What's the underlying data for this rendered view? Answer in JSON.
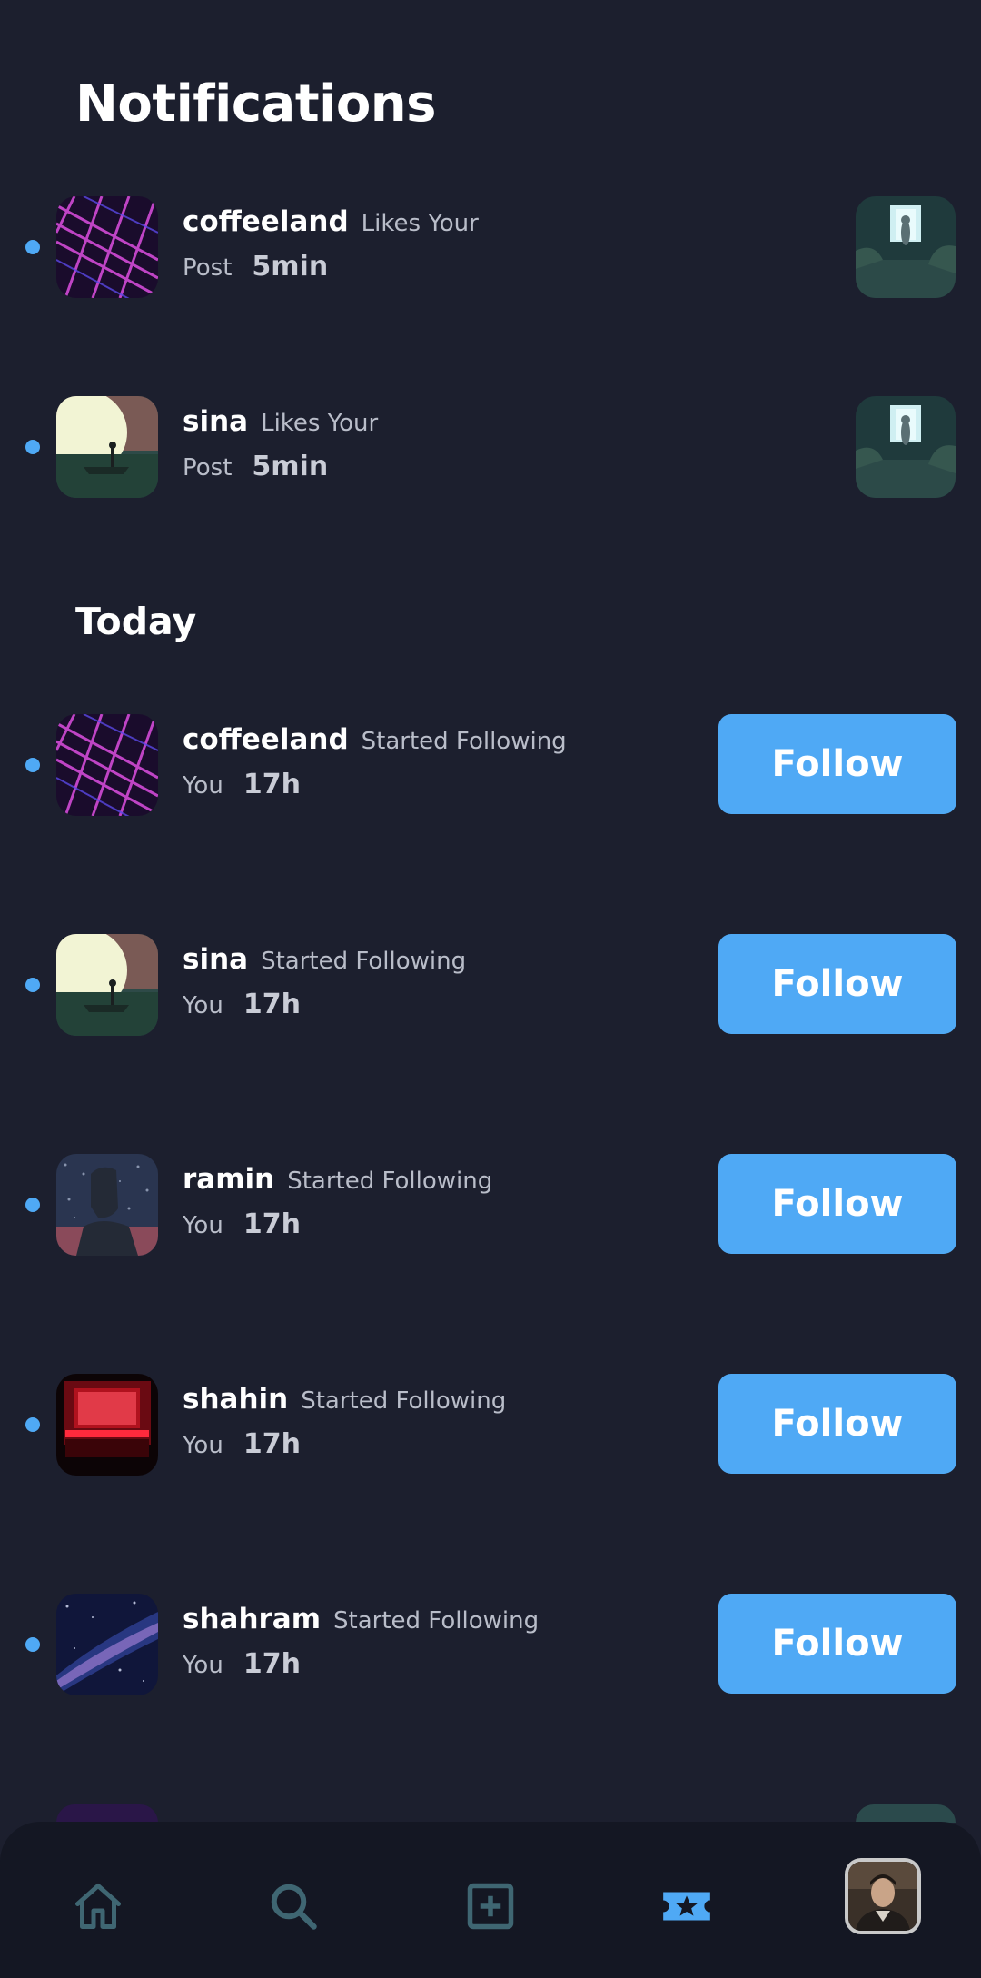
{
  "header": {
    "title": "Notifications"
  },
  "likes": [
    {
      "user": "coffeeland",
      "action": "Likes Your",
      "action2": "Post",
      "time": "5min"
    },
    {
      "user": "sina",
      "action": "Likes Your",
      "action2": "Post",
      "time": "5min"
    }
  ],
  "today": {
    "title": "Today",
    "items": [
      {
        "user": "coffeeland",
        "action": "Started Following",
        "action2": "You",
        "time": "17h",
        "button": "Follow"
      },
      {
        "user": "sina",
        "action": "Started Following",
        "action2": "You",
        "time": "17h",
        "button": "Follow"
      },
      {
        "user": "ramin",
        "action": "Started Following",
        "action2": "You",
        "time": "17h",
        "button": "Follow"
      },
      {
        "user": "shahin",
        "action": "Started Following",
        "action2": "You",
        "time": "17h",
        "button": "Follow"
      },
      {
        "user": "shahram",
        "action": "Started Following",
        "action2": "You",
        "time": "17h",
        "button": "Follow"
      }
    ]
  },
  "colors": {
    "background": "#1c1f2e",
    "accent": "#4fa9f5",
    "nav_background": "#141723",
    "nav_icon": "#3f6672"
  },
  "nav": {
    "icons": [
      "home-icon",
      "search-icon",
      "add-post-icon",
      "activity-icon",
      "profile-avatar"
    ],
    "active": "activity-icon"
  }
}
